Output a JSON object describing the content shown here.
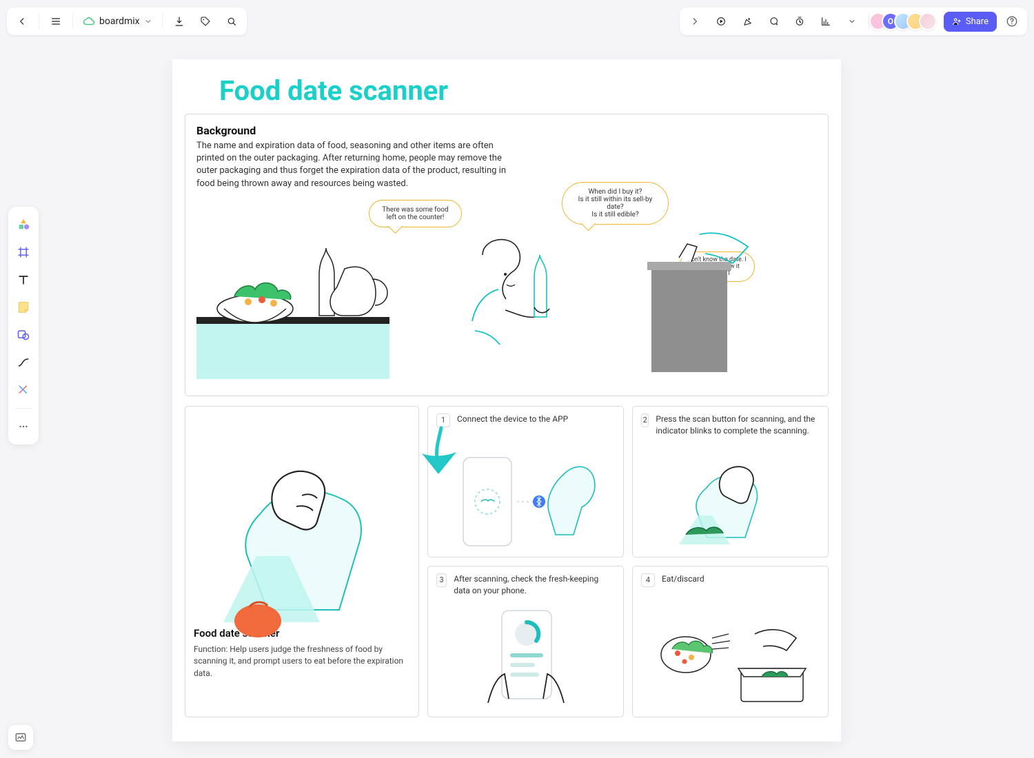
{
  "toolbar": {
    "brand_label": "boardmix",
    "share_label": "Share",
    "me_initial": "O"
  },
  "canvas": {
    "title": "Food date scanner",
    "background_heading": "Background",
    "background_text": "The name and expiration data of food, seasoning and other items are often printed on the outer packaging. After returning home, people may remove the outer packaging and thus forget the expiration data of the product, resulting in food being thrown away and resources being wasted.",
    "bubble1": "There was some food left on the counter!",
    "bubble2": "When did I buy it?\nIs it still within its sell-by date?\nIs it still edible?",
    "bubble3": "Don't know the date. I can only throw it away. TAT",
    "big_card_title": "Food date scanner",
    "big_card_text": "Function: Help users judge the freshness of food by scanning it, and prompt users to eat before the expiration data.",
    "steps": [
      {
        "num": "1",
        "text": "Connect the device to the APP"
      },
      {
        "num": "2",
        "text": "Press the scan button for scanning, and the indicator blinks to complete the scanning."
      },
      {
        "num": "3",
        "text": "After scanning, check the fresh-keeping data on your phone."
      },
      {
        "num": "4",
        "text": "Eat/discard"
      }
    ]
  }
}
